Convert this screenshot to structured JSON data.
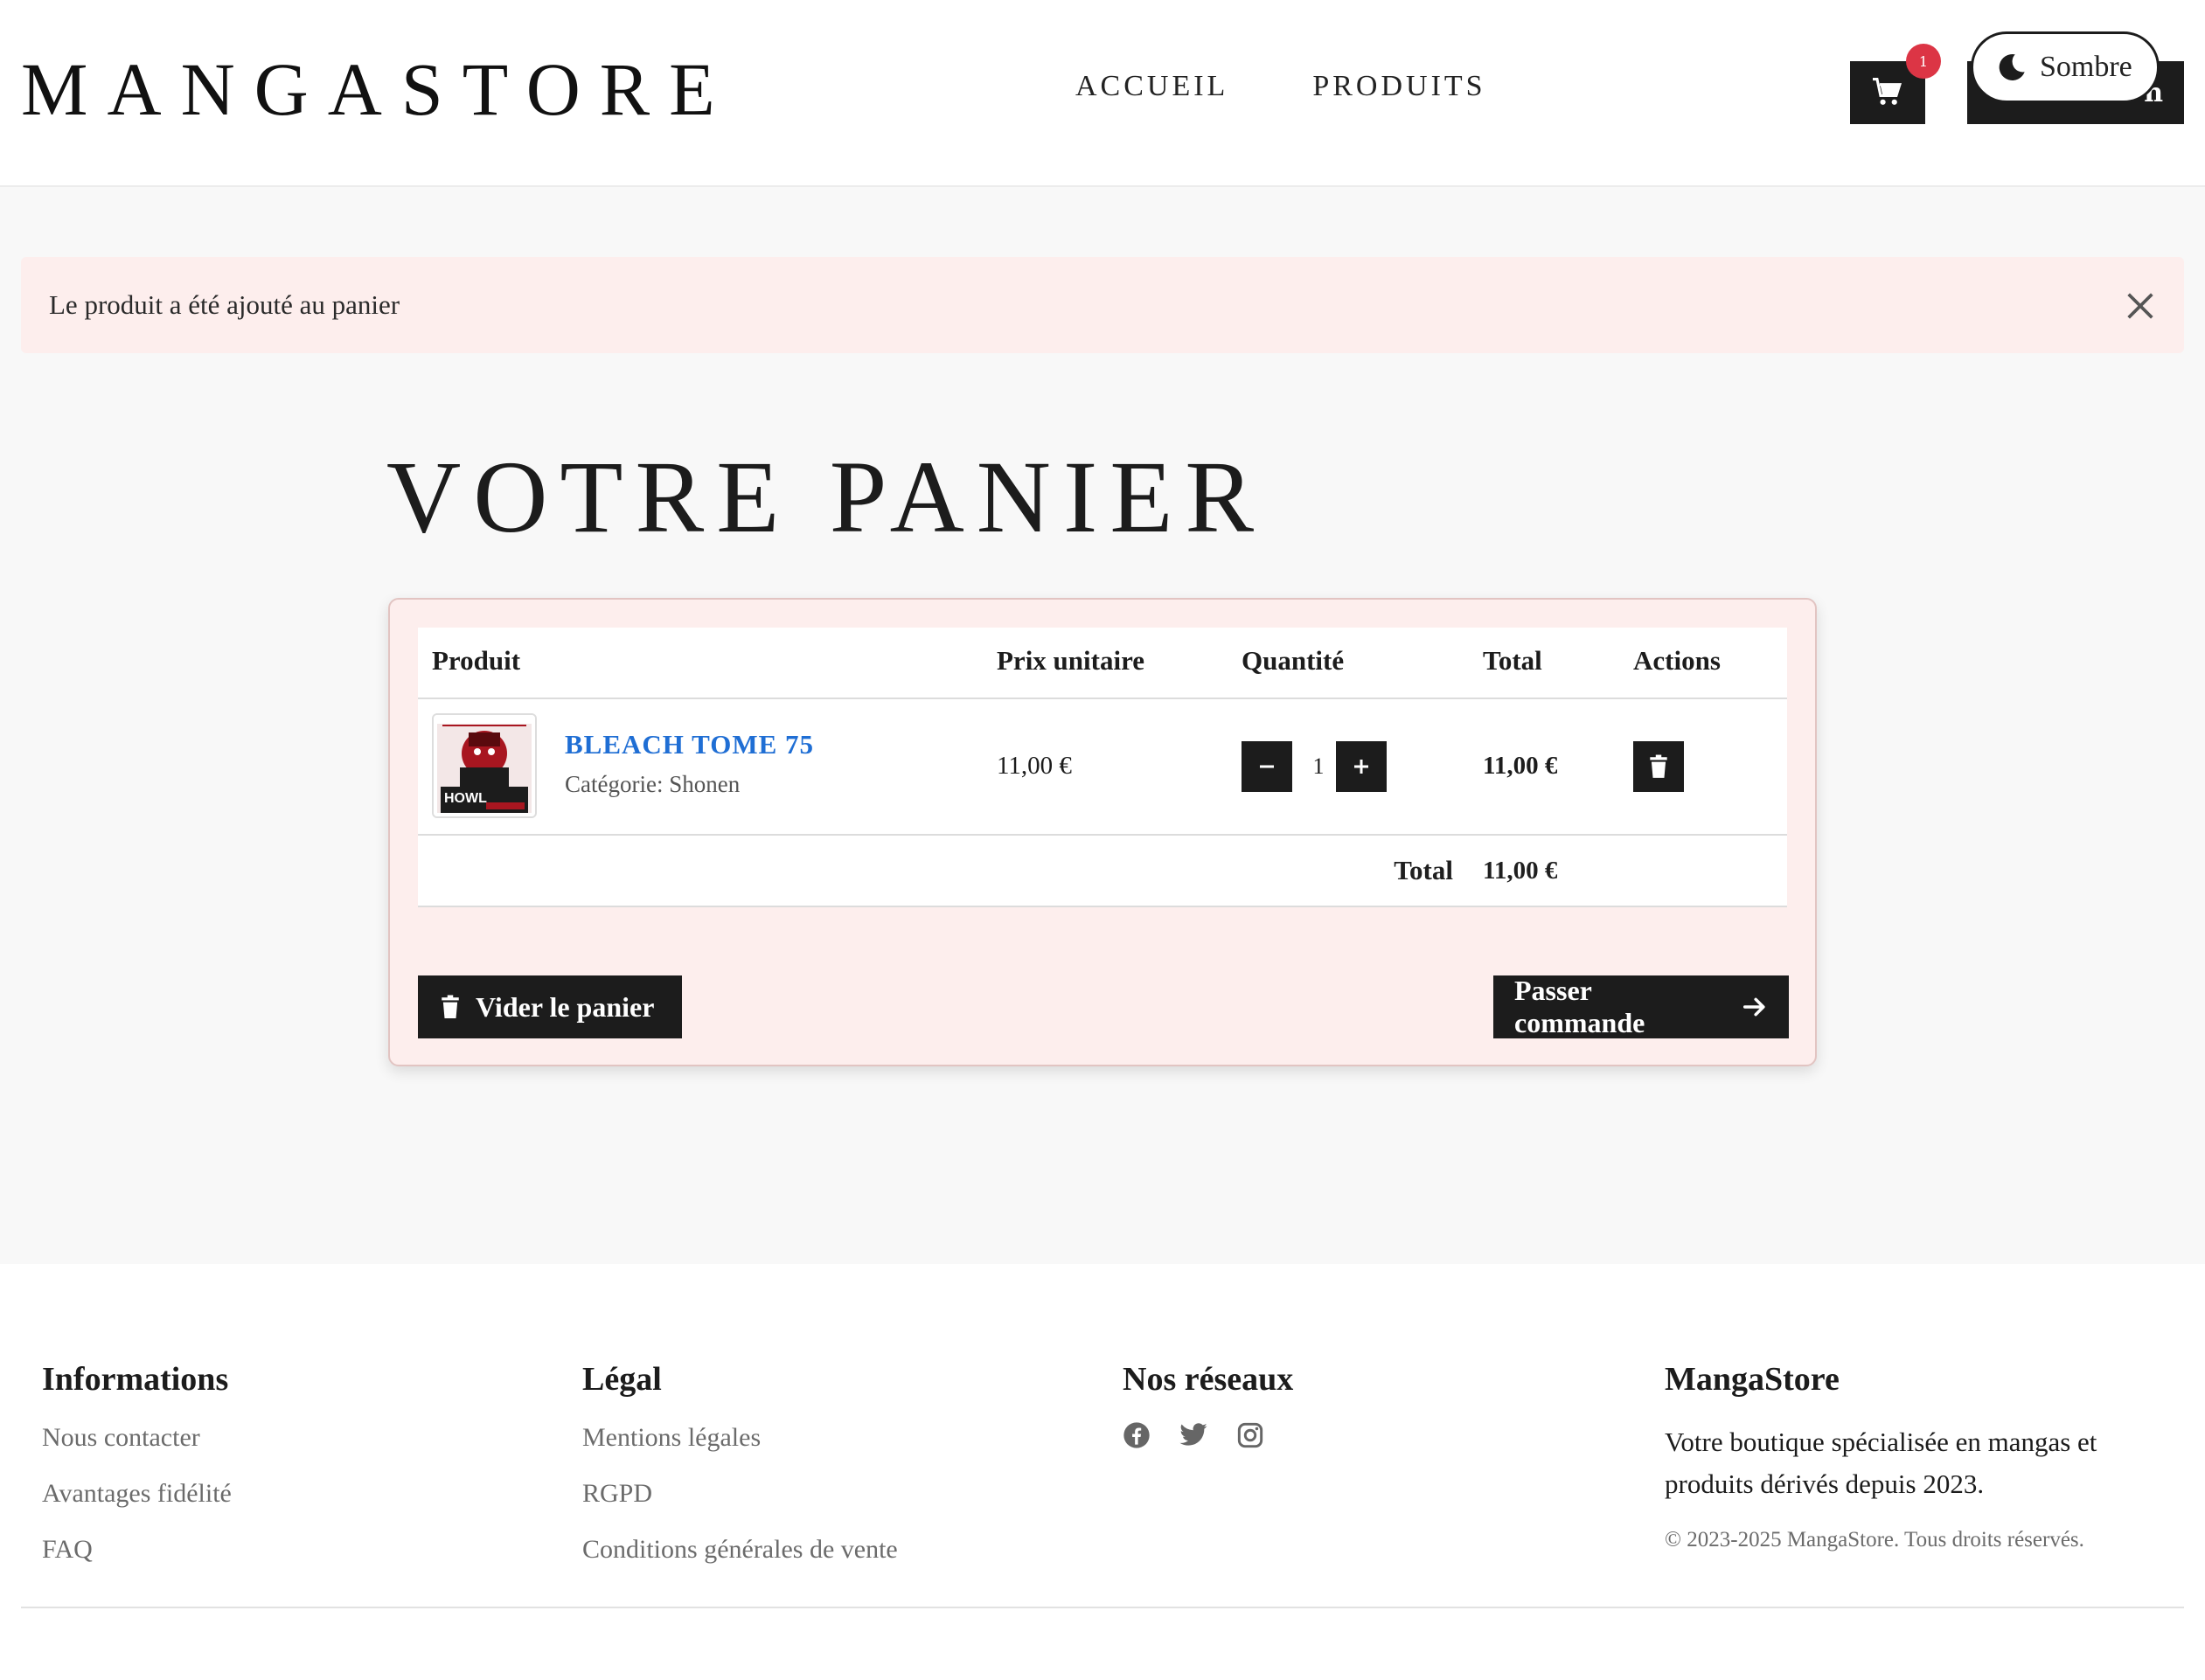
{
  "brand": "MANGASTORE",
  "nav": [
    "ACCUEIL",
    "PRODUITS"
  ],
  "header": {
    "cart_count": "1",
    "account_label": "n",
    "theme_label": "Sombre"
  },
  "alert": {
    "message": "Le produit a été ajouté au panier"
  },
  "page_title": "VOTRE PANIER",
  "cart": {
    "columns": [
      "Produit",
      "Prix unitaire",
      "Quantité",
      "Total",
      "Actions"
    ],
    "items": [
      {
        "name": "BLEACH TOME 75",
        "category": "Catégorie: Shonen",
        "unit_price": "11,00 €",
        "quantity": "1",
        "total": "11,00 €",
        "thumb_text": "HOWL"
      }
    ],
    "total_label": "Total",
    "total_value": "11,00 €",
    "empty_label": "Vider le panier",
    "checkout_label": "Passer commande"
  },
  "footer": {
    "info": {
      "title": "Informations",
      "links": [
        "Nous contacter",
        "Avantages fidélité",
        "FAQ"
      ]
    },
    "legal": {
      "title": "Légal",
      "links": [
        "Mentions légales",
        "RGPD",
        "Conditions générales de vente"
      ]
    },
    "social": {
      "title": "Nos réseaux",
      "icons": [
        "facebook-icon",
        "twitter-icon",
        "instagram-icon"
      ]
    },
    "about": {
      "title": "MangaStore",
      "text": "Votre boutique spécialisée en mangas et produits dérivés depuis 2023.",
      "copyright": "© 2023-2025 MangaStore. Tous droits réservés."
    }
  },
  "colors": {
    "dark": "#1c1c1c",
    "alert_bg": "#fdeeed",
    "link_blue": "#1f6ed4",
    "badge_red": "#dc3545"
  }
}
